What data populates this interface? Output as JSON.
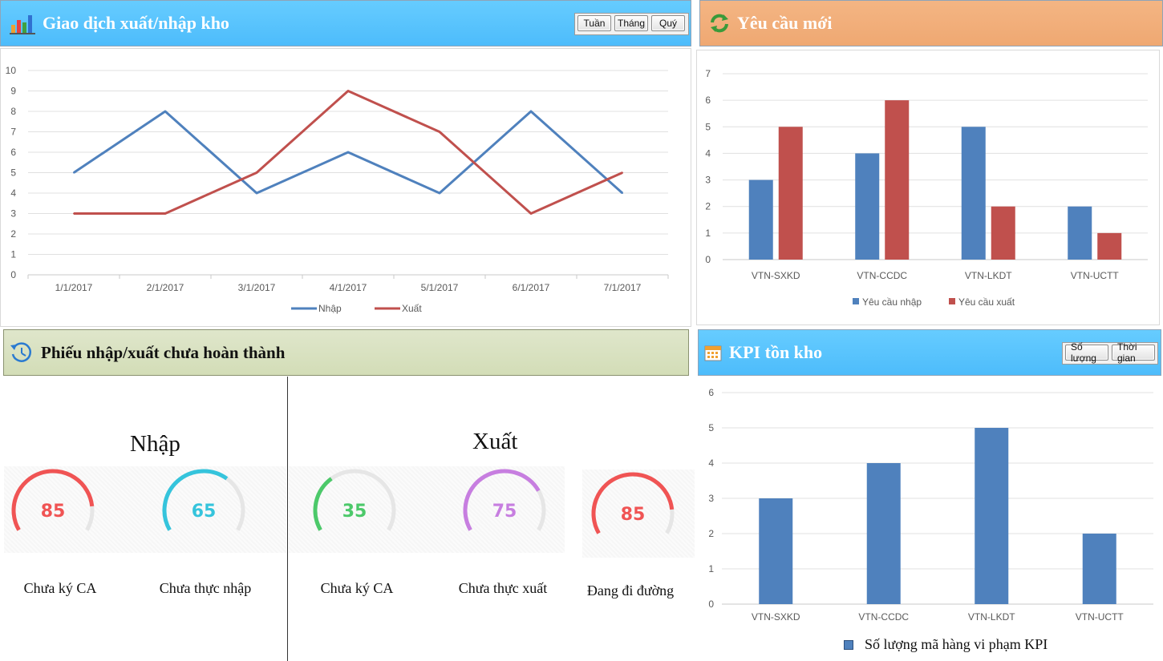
{
  "panels": {
    "transactions": {
      "title": "Giao dịch xuất/nhập kho",
      "buttons": [
        "Tuần",
        "Tháng",
        "Quý"
      ]
    },
    "requests": {
      "title": "Yêu cầu mới"
    },
    "pending": {
      "title": "Phiếu nhập/xuất chưa hoàn thành"
    },
    "kpi": {
      "title": "KPI tồn kho",
      "buttons": [
        "Số lượng",
        "Thời gian"
      ]
    }
  },
  "pending": {
    "import_title": "Nhập",
    "export_title": "Xuất",
    "gauges": [
      {
        "value": 85,
        "display": "85",
        "label": "Chưa ký CA",
        "color": "#f05454"
      },
      {
        "value": 65,
        "display": "65",
        "label": "Chưa thực nhập",
        "color": "#35c4dc"
      },
      {
        "value": 35,
        "display": "35",
        "label": "Chưa ký CA",
        "color": "#4cc96a"
      },
      {
        "value": 75,
        "display": "75",
        "label": "Chưa thực xuất",
        "color": "#c77ee0"
      },
      {
        "value": 85,
        "display": "85",
        "label": "Đang đi đường",
        "color": "#f05454"
      }
    ]
  },
  "colors": {
    "blue": "#4f81bd",
    "red": "#c0504d",
    "header_blue": "#55c2fc",
    "header_orange": "#f1ad78",
    "header_green": "#d8e0c0"
  },
  "icons": {
    "transactions": "bar-chart-icon",
    "requests": "refresh-icon",
    "pending": "history-icon",
    "kpi": "calendar-icon"
  },
  "chart_data": [
    {
      "type": "line",
      "categories": [
        "1/1/2017",
        "2/1/2017",
        "3/1/2017",
        "4/1/2017",
        "5/1/2017",
        "6/1/2017",
        "7/1/2017"
      ],
      "series": [
        {
          "name": "Nhập",
          "color": "#4f81bd",
          "values": [
            5,
            8,
            4,
            6,
            4,
            8,
            4
          ]
        },
        {
          "name": "Xuất",
          "color": "#c0504d",
          "values": [
            3,
            3,
            5,
            9,
            7,
            3,
            5
          ]
        }
      ],
      "ylim": [
        0,
        10
      ],
      "yticks": [
        0,
        1,
        2,
        3,
        4,
        5,
        6,
        7,
        8,
        9,
        10
      ],
      "grid": true,
      "legend": "bottom"
    },
    {
      "type": "bar",
      "categories": [
        "VTN-SXKD",
        "VTN-CCDC",
        "VTN-LKDT",
        "VTN-UCTT"
      ],
      "series": [
        {
          "name": "Yêu cầu nhập",
          "color": "#4f81bd",
          "values": [
            3,
            4,
            5,
            2
          ]
        },
        {
          "name": "Yêu cầu xuất",
          "color": "#c0504d",
          "values": [
            5,
            6,
            2,
            1
          ]
        }
      ],
      "ylim": [
        0,
        7
      ],
      "yticks": [
        0,
        1,
        2,
        3,
        4,
        5,
        6,
        7
      ],
      "grid": true,
      "legend": "bottom"
    },
    {
      "type": "bar",
      "categories": [
        "VTN-SXKD",
        "VTN-CCDC",
        "VTN-LKDT",
        "VTN-UCTT"
      ],
      "series": [
        {
          "name": "Số lượng mã hàng vi phạm KPI",
          "color": "#4f81bd",
          "values": [
            3,
            4,
            5,
            2
          ]
        }
      ],
      "ylim": [
        0,
        6
      ],
      "yticks": [
        0,
        1,
        2,
        3,
        4,
        5,
        6
      ],
      "grid": true,
      "legend": "bottom"
    }
  ]
}
